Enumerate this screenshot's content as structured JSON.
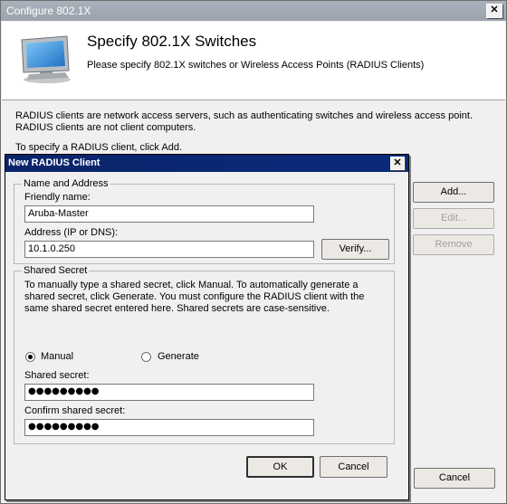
{
  "outer": {
    "title": "Configure 802.1X",
    "close": "✕",
    "heading": "Specify 802.1X Switches",
    "subheading": "Please specify 802.1X switches or Wireless Access Points (RADIUS Clients)",
    "para1": "RADIUS clients are network access servers, such as authenticating switches and wireless access point. RADIUS clients are not client computers.",
    "para2": "To specify a RADIUS client, click Add.",
    "buttons": {
      "add": "Add...",
      "edit": "Edit...",
      "remove": "Remove",
      "cancel": "Cancel"
    }
  },
  "dialog": {
    "title": "New RADIUS Client",
    "close": "✕",
    "name_group": {
      "legend": "Name and Address",
      "friendly_label": "Friendly name:",
      "friendly_value": "Aruba-Master",
      "address_label": "Address (IP or DNS):",
      "address_value": "10.1.0.250",
      "verify": "Verify..."
    },
    "secret_group": {
      "legend": "Shared Secret",
      "description": "To manually type a shared secret, click Manual. To automatically generate a shared secret, click Generate. You must configure the RADIUS client with the same shared secret entered here. Shared secrets are case-sensitive.",
      "manual": "Manual",
      "generate": "Generate",
      "selected": "Manual",
      "secret_label": "Shared secret:",
      "secret_value": "●●●●●●●●●",
      "confirm_label": "Confirm shared secret:",
      "confirm_value": "●●●●●●●●●"
    },
    "buttons": {
      "ok": "OK",
      "cancel": "Cancel"
    }
  }
}
